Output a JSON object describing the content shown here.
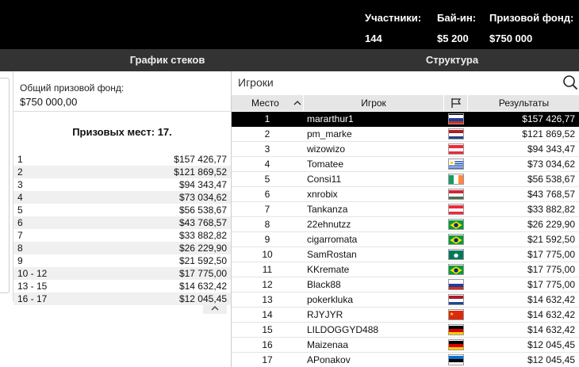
{
  "header": {
    "participants_label": "Участники:",
    "participants_value": "144",
    "buyin_label": "Бай-ин:",
    "buyin_value": "$5 200",
    "prize_label": "Призовой фонд:",
    "prize_value": "$750 000"
  },
  "tabs": [
    {
      "label": "График стеков"
    },
    {
      "label": "Структура"
    }
  ],
  "left": {
    "pool_label": "Общий призовой фонд:",
    "pool_value": "$750 000,00",
    "paid_places": "Призовых мест: 17.",
    "payouts": [
      {
        "place": "1",
        "amount": "$157 426,77"
      },
      {
        "place": "2",
        "amount": "$121 869,52"
      },
      {
        "place": "3",
        "amount": "$94 343,47"
      },
      {
        "place": "4",
        "amount": "$73 034,62"
      },
      {
        "place": "5",
        "amount": "$56 538,67"
      },
      {
        "place": "6",
        "amount": "$43 768,57"
      },
      {
        "place": "7",
        "amount": "$33 882,82"
      },
      {
        "place": "8",
        "amount": "$26 229,90"
      },
      {
        "place": "9",
        "amount": "$21 592,50"
      },
      {
        "place": "10 - 12",
        "amount": "$17 775,00"
      },
      {
        "place": "13 - 15",
        "amount": "$14 632,42"
      },
      {
        "place": "16 - 17",
        "amount": "$12 045,45"
      }
    ],
    "collapse_icon": "chevron-up-icon"
  },
  "players": {
    "search_placeholder": "Игроки",
    "columns": {
      "place": "Место",
      "player": "Игрок",
      "flag": "flag-icon",
      "results": "Результаты"
    },
    "sort_icon": "chevron-up-icon",
    "selected_row": 0,
    "rows": [
      {
        "place": "1",
        "name": "mararthur1",
        "flag": "ru",
        "result": "$157 426,77"
      },
      {
        "place": "2",
        "name": "pm_marke",
        "flag": "nl",
        "result": "$121 869,52"
      },
      {
        "place": "3",
        "name": "wizowizo",
        "flag": "at",
        "result": "$94 343,47"
      },
      {
        "place": "4",
        "name": "Tomatee",
        "flag": "uy",
        "result": "$73 034,62"
      },
      {
        "place": "5",
        "name": "Consi11",
        "flag": "ie",
        "result": "$56 538,67"
      },
      {
        "place": "6",
        "name": "xnrobix",
        "flag": "hu",
        "result": "$43 768,57"
      },
      {
        "place": "7",
        "name": "Tankanza",
        "flag": "at",
        "result": "$33 882,82"
      },
      {
        "place": "8",
        "name": "22ehnutzz",
        "flag": "br",
        "result": "$26 229,90"
      },
      {
        "place": "9",
        "name": "cigarromata",
        "flag": "br",
        "result": "$21 592,50"
      },
      {
        "place": "10",
        "name": "SamRostan",
        "flag": "mo",
        "result": "$17 775,00"
      },
      {
        "place": "11",
        "name": "KKremate",
        "flag": "br",
        "result": "$17 775,00"
      },
      {
        "place": "12",
        "name": "Black88",
        "flag": "ru",
        "result": "$17 775,00"
      },
      {
        "place": "13",
        "name": "pokerkluka",
        "flag": "nl",
        "result": "$14 632,42"
      },
      {
        "place": "14",
        "name": "RJYJYR",
        "flag": "cn",
        "result": "$14 632,42"
      },
      {
        "place": "15",
        "name": "LILDOGGYD488",
        "flag": "de",
        "result": "$14 632,42"
      },
      {
        "place": "16",
        "name": "Maizenaa",
        "flag": "de",
        "result": "$12 045,45"
      },
      {
        "place": "17",
        "name": "APonakov",
        "flag": "ee",
        "result": "$12 045,45"
      }
    ]
  },
  "colors": {
    "header_bg": "#000000",
    "tab_bar_bg": "#333333",
    "selected_row_bg": "#000000",
    "table_header_bg": "#e6e6e6"
  }
}
